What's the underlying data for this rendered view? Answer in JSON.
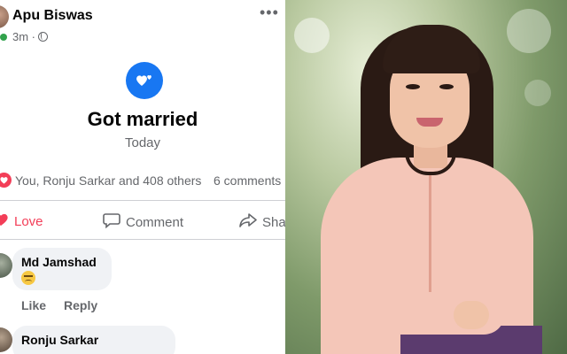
{
  "post": {
    "author": "Apu Biswas",
    "time": "3m ·",
    "more": "•••",
    "event_title": "Got married",
    "event_date": "Today",
    "reactions_text": "You, Ronju Sarkar and 408 others",
    "comments_count": "6 comments"
  },
  "actions": {
    "love": "Love",
    "comment": "Comment",
    "share": "Sha"
  },
  "comments": [
    {
      "name": "Md Jamshad",
      "emoji": "disappointed-face"
    },
    {
      "name": "Ronju Sarkar"
    }
  ],
  "comment_actions": {
    "like": "Like",
    "reply": "Reply"
  },
  "colors": {
    "brand_blue": "#1877f2",
    "love_red": "#f33e58",
    "muted": "#65676b"
  },
  "photo": {
    "subject": "portrait"
  }
}
